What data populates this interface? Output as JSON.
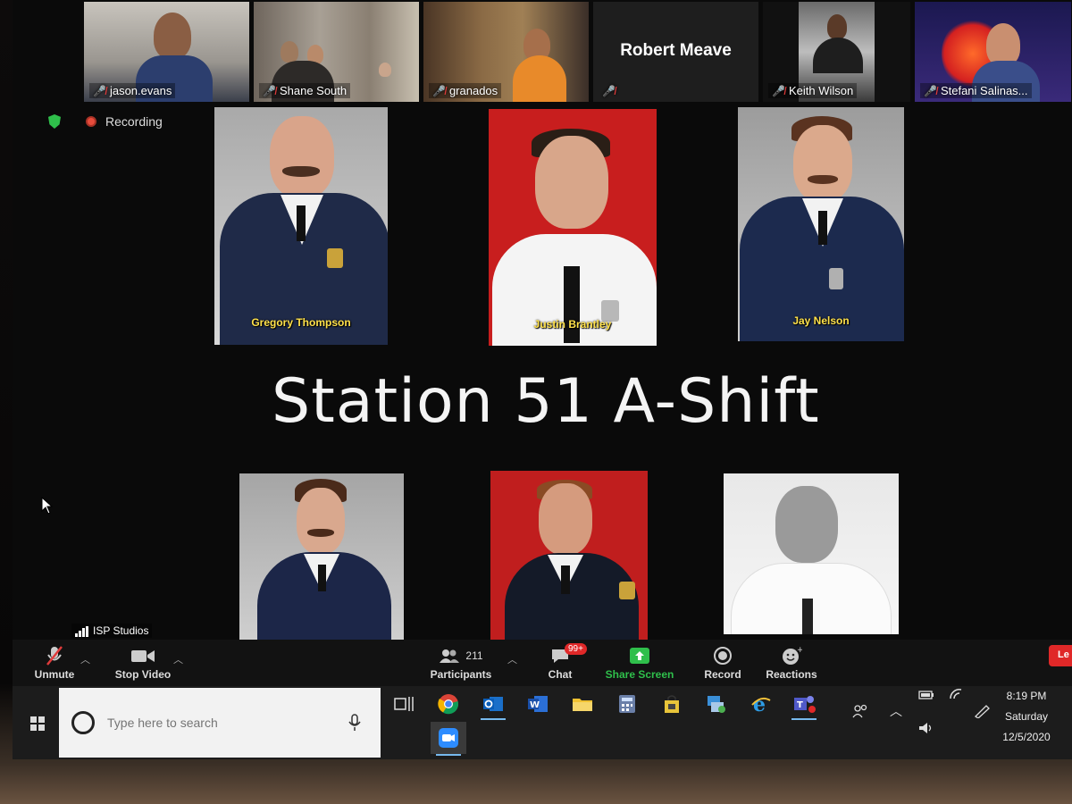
{
  "participants": [
    {
      "name": "jason.evans",
      "muted": true
    },
    {
      "name": "Shane South",
      "muted": true
    },
    {
      "name": "granados",
      "muted": true
    },
    {
      "name": "Robert Meave",
      "muted": true,
      "video": false
    },
    {
      "name": "Keith Wilson",
      "muted": true
    },
    {
      "name": "Stefani Salinas...",
      "muted": true
    }
  ],
  "status": {
    "recording_label": "Recording"
  },
  "share": {
    "title": "Station 51 A-Shift",
    "captions": [
      "Gregory Thompson",
      "Justin Brantley",
      "Jay Nelson"
    ],
    "presenter_label": "ISP Studios"
  },
  "toolbar": {
    "unmute": "Unmute",
    "stop_video": "Stop Video",
    "participants": "Participants",
    "participants_count": "211",
    "chat": "Chat",
    "chat_badge": "99+",
    "share_screen": "Share Screen",
    "record": "Record",
    "reactions": "Reactions",
    "leave": "Le"
  },
  "taskbar": {
    "search_placeholder": "Type here to search",
    "time": "8:19 PM",
    "day": "Saturday",
    "date": "12/5/2020"
  },
  "colors": {
    "share_screen_green": "#2fbf4b",
    "leave_red": "#e02828",
    "caption_yellow": "#ffe14a"
  }
}
